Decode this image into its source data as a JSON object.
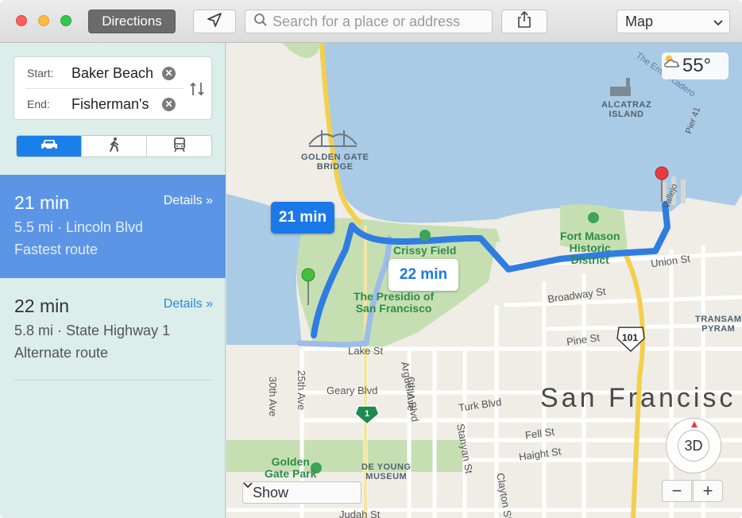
{
  "toolbar": {
    "directions_label": "Directions",
    "search_placeholder": "Search for a place or address",
    "map_mode": "Map"
  },
  "route_form": {
    "start_label": "Start:",
    "start_value": "Baker Beach",
    "end_label": "End:",
    "end_value": "Fisherman's"
  },
  "transport_modes": [
    {
      "name": "car-icon",
      "selected": true
    },
    {
      "name": "walk-icon",
      "selected": false
    },
    {
      "name": "transit-icon",
      "selected": false
    }
  ],
  "routes": [
    {
      "time": "21 min",
      "details": "Details »",
      "distance_via": "5.5 mi · Lincoln Blvd",
      "note": "Fastest route",
      "selected": true
    },
    {
      "time": "22 min",
      "details": "Details »",
      "distance_via": "5.8 mi · State Highway 1",
      "note": "Alternate route",
      "selected": false
    }
  ],
  "map": {
    "weather": "55°",
    "bubble_main": "21 min",
    "bubble_alt": "22 min",
    "city": "San Francisc",
    "show_label": "Show",
    "compass_label": "3D",
    "zoom_out": "−",
    "zoom_in": "+",
    "landmarks": {
      "golden_gate": "GOLDEN GATE\nBRIDGE",
      "alcatraz": "ALCATRAZ\nISLAND",
      "de_young": "DE YOUNG\nMUSEUM",
      "transamerica": "TRANSAM\nPYRAM"
    },
    "parks": {
      "crissy": "Crissy Field",
      "presidio": "The Presidio of\nSan Francisco",
      "fort_mason": "Fort Mason\nHistoric\nDistrict",
      "golden_gate_park": "Golden\nGate Park"
    },
    "streets": {
      "lake": "Lake St",
      "geary": "Geary Blvd",
      "turk": "Turk Blvd",
      "fell": "Fell St",
      "haight": "Haight St",
      "judah": "Judah St",
      "broadway": "Broadway St",
      "union": "Union St",
      "pine": "Pine St",
      "arguello": "Arguello Blvd",
      "sixth": "6th Ave",
      "twentyfifth": "25th Ave",
      "thirtieth": "30th Ave",
      "stanyan": "Stanyan St",
      "clayton": "Clayton St",
      "pier": "Pier 41",
      "vallejo": "Vallejo",
      "tf_street": "The Embarcadero"
    },
    "shields": {
      "hwy1": "1",
      "us101": "101"
    }
  },
  "colors": {
    "route_primary": "#2f7de1",
    "route_alt": "#9dbcea",
    "selected_row": "#5c95e6",
    "water": "#aacbe6",
    "land": "#efede6",
    "park": "#c5dfb2"
  }
}
